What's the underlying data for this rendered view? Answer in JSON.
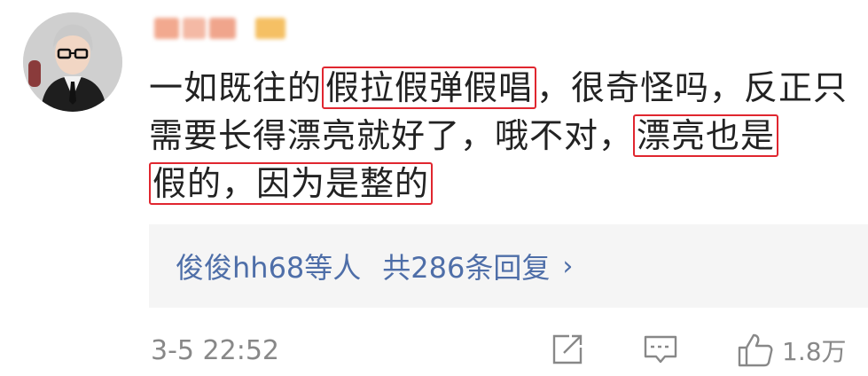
{
  "comment": {
    "segments": [
      {
        "text": "一如既往的",
        "highlight": false
      },
      {
        "text": "假拉假弹假唱",
        "highlight": true
      },
      {
        "text": "，很奇怪吗，反正只需要长得漂亮就好了，哦不对，",
        "highlight": false
      },
      {
        "text": "漂亮也是",
        "highlight": true
      },
      {
        "text": "假的，因为是整的",
        "highlight": true
      }
    ]
  },
  "replies": {
    "who": "俊俊hh68等人",
    "count_text": "共286条回复",
    "chevron": "›"
  },
  "footer": {
    "time": "3-5 22:52",
    "like_count": "1.8万",
    "icons": [
      "share-icon",
      "comment-icon",
      "like-icon"
    ]
  },
  "colors": {
    "highlight_border": "#e0262f",
    "reply_link": "#4e6ea8",
    "meta_gray": "#888888"
  }
}
